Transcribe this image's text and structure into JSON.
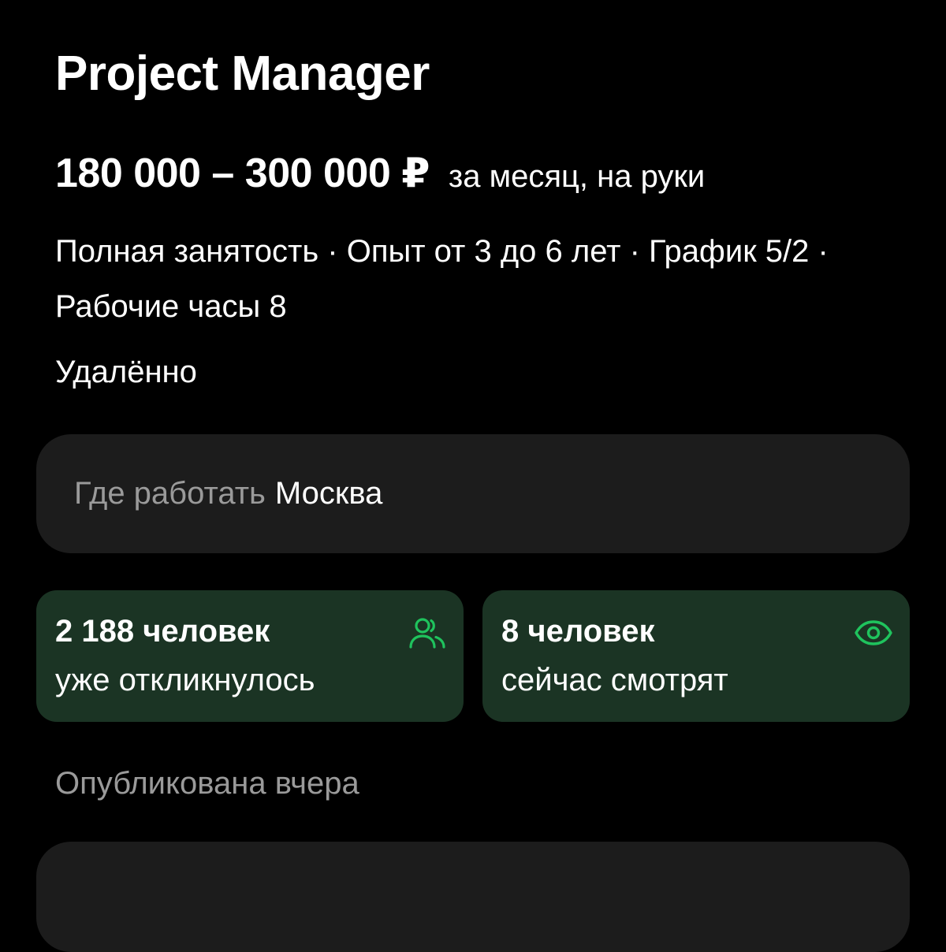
{
  "vacancy": {
    "title": "Project Manager",
    "salary_amount": "180 000 – 300 000 ₽",
    "salary_note": "за месяц, на руки",
    "conditions": "Полная занятость · Опыт от 3 до 6 лет · График 5/2 · Рабочие часы 8",
    "work_format": "Удалённо"
  },
  "location": {
    "label": "Где работать",
    "value": "Москва"
  },
  "stats": {
    "responses": {
      "count": "2 188 человек",
      "caption": "уже откликнулось",
      "icon": "people-icon"
    },
    "viewers": {
      "count": "8 человек",
      "caption": "сейчас смотрят",
      "icon": "eye-icon"
    }
  },
  "published": "Опубликована вчера",
  "colors": {
    "background": "#000000",
    "card": "#1c1c1c",
    "stat_card": "#1b3424",
    "accent_green": "#1fc35d",
    "muted_text": "#9a9a9a"
  }
}
